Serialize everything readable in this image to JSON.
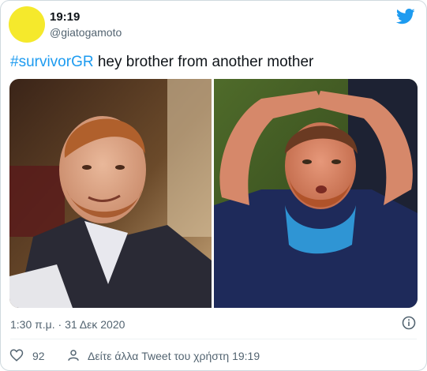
{
  "tweet": {
    "author": {
      "name": "19:19",
      "handle": "@giatogamoto",
      "avatar_color": "#f5e92c"
    },
    "brand_icon": "twitter-bird-icon",
    "text": {
      "hashtag": "#survivorGR",
      "body": " hey brother from another mother"
    },
    "images": [
      {
        "name": "photo-left",
        "alt": "man in dark suit smiling"
      },
      {
        "name": "photo-right",
        "alt": "man in blue t-shirt with hands on head"
      }
    ],
    "timestamp": "1:30 π.μ. · 31 Δεκ 2020",
    "info_icon": "info-icon",
    "actions": {
      "like_count": "92",
      "profile_link": "Δείτε άλλα Tweet του χρήστη 19:19"
    },
    "colors": {
      "accent": "#1d9bf0",
      "muted": "#536471",
      "border": "#cfd9de"
    }
  }
}
